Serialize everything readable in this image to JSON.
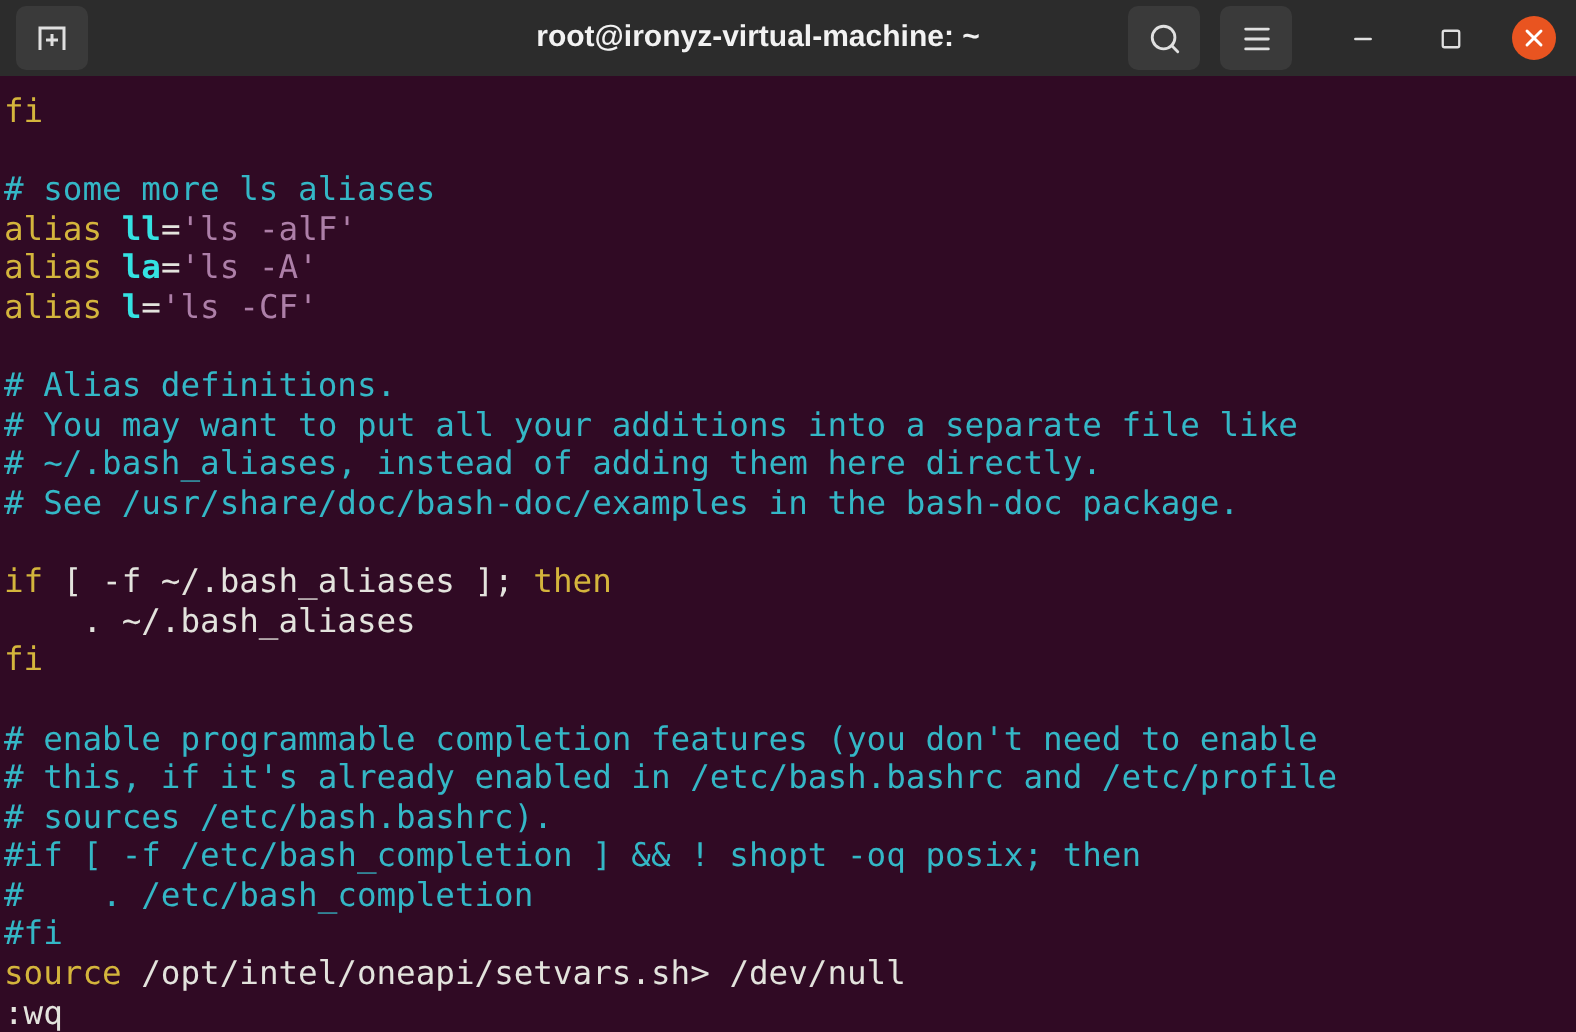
{
  "window": {
    "title": "root@ironyz-virtual-machine: ~"
  },
  "lines": [
    {
      "kind": "text",
      "segments": [
        {
          "text": "fi",
          "kind": "keyword"
        }
      ]
    },
    {
      "kind": "blank"
    },
    {
      "kind": "text",
      "segments": [
        {
          "text": "# some more ls aliases",
          "kind": "comment"
        }
      ]
    },
    {
      "kind": "text",
      "segments": [
        {
          "text": "alias ",
          "kind": "keyword"
        },
        {
          "text": "ll",
          "kind": "ident"
        },
        {
          "text": "=",
          "kind": "plain"
        },
        {
          "text": "'ls -alF'",
          "kind": "string"
        }
      ]
    },
    {
      "kind": "text",
      "segments": [
        {
          "text": "alias ",
          "kind": "keyword"
        },
        {
          "text": "la",
          "kind": "ident"
        },
        {
          "text": "=",
          "kind": "plain"
        },
        {
          "text": "'ls -A'",
          "kind": "string"
        }
      ]
    },
    {
      "kind": "text",
      "segments": [
        {
          "text": "alias ",
          "kind": "keyword"
        },
        {
          "text": "l",
          "kind": "ident"
        },
        {
          "text": "=",
          "kind": "plain"
        },
        {
          "text": "'ls -CF'",
          "kind": "string"
        }
      ]
    },
    {
      "kind": "blank"
    },
    {
      "kind": "text",
      "segments": [
        {
          "text": "# Alias definitions.",
          "kind": "comment"
        }
      ]
    },
    {
      "kind": "text",
      "segments": [
        {
          "text": "# You may want to put all your additions into a separate file like",
          "kind": "comment"
        }
      ]
    },
    {
      "kind": "text",
      "segments": [
        {
          "text": "# ~/.bash_aliases, instead of adding them here directly.",
          "kind": "comment"
        }
      ]
    },
    {
      "kind": "text",
      "segments": [
        {
          "text": "# See /usr/share/doc/bash-doc/examples in the bash-doc package.",
          "kind": "comment"
        }
      ]
    },
    {
      "kind": "blank"
    },
    {
      "kind": "text",
      "segments": [
        {
          "text": "if",
          "kind": "keyword"
        },
        {
          "text": " [ -f ~/.bash_aliases ]; ",
          "kind": "plain"
        },
        {
          "text": "then",
          "kind": "keyword"
        }
      ]
    },
    {
      "kind": "text",
      "segments": [
        {
          "text": "    . ~/.bash_aliases",
          "kind": "plain"
        }
      ]
    },
    {
      "kind": "text",
      "segments": [
        {
          "text": "fi",
          "kind": "keyword"
        }
      ]
    },
    {
      "kind": "blank"
    },
    {
      "kind": "text",
      "segments": [
        {
          "text": "# enable programmable completion features (you don't need to enable",
          "kind": "comment"
        }
      ]
    },
    {
      "kind": "text",
      "segments": [
        {
          "text": "# this, if it's already enabled in /etc/bash.bashrc and /etc/profile",
          "kind": "comment"
        }
      ]
    },
    {
      "kind": "text",
      "segments": [
        {
          "text": "# sources /etc/bash.bashrc).",
          "kind": "comment"
        }
      ]
    },
    {
      "kind": "text",
      "segments": [
        {
          "text": "#if [ -f /etc/bash_completion ] && ! shopt -oq posix; then",
          "kind": "comment"
        }
      ]
    },
    {
      "kind": "text",
      "segments": [
        {
          "text": "#    . /etc/bash_completion",
          "kind": "comment"
        }
      ]
    },
    {
      "kind": "text",
      "segments": [
        {
          "text": "#fi",
          "kind": "comment"
        }
      ]
    },
    {
      "kind": "text",
      "segments": [
        {
          "text": "source",
          "kind": "keyword"
        },
        {
          "text": " /opt/intel/oneapi/setvars.sh> /dev/null",
          "kind": "plain"
        }
      ]
    },
    {
      "kind": "text",
      "segments": [
        {
          "text": ":wq",
          "kind": "plain"
        }
      ]
    }
  ]
}
